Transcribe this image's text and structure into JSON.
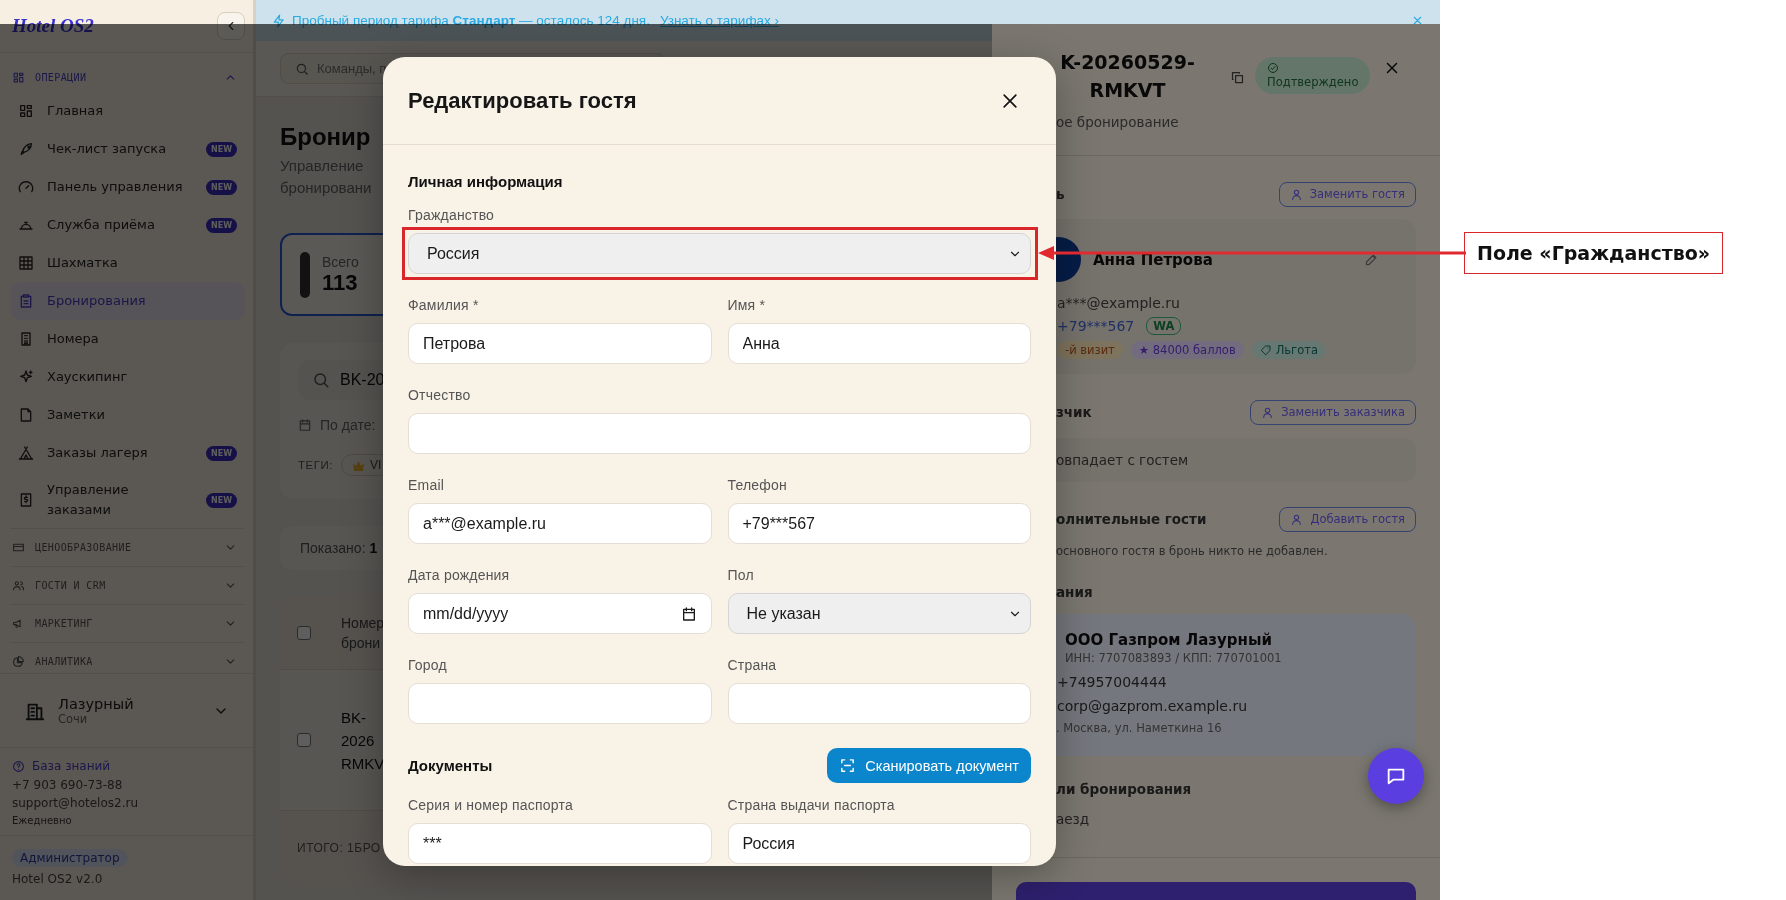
{
  "banner": {
    "text": "Пробный период тарифа **Стандарт** — осталось 124 дня.",
    "link": "Узнать о тарифах ›"
  },
  "sidebar": {
    "logo": "Hotel OS2",
    "sections": [
      {
        "label": "ОПЕРАЦИИ",
        "expanded": true,
        "items": [
          {
            "label": "Главная",
            "selected": false
          },
          {
            "label": "Чек-лист запуска",
            "badge": "NEW",
            "selected": false
          },
          {
            "label": "Панель управления",
            "badge": "NEW",
            "selected": false
          },
          {
            "label": "Служба приёма",
            "badge": "NEW",
            "selected": false
          },
          {
            "label": "Шахматка",
            "selected": false
          },
          {
            "label": "Бронирования",
            "selected": true
          },
          {
            "label": "Номера",
            "selected": false
          },
          {
            "label": "Хаускипинг",
            "selected": false
          },
          {
            "label": "Заметки",
            "selected": false
          },
          {
            "label": "Заказы лагеря",
            "badge": "NEW",
            "selected": false
          },
          {
            "label": "Управление заказами",
            "badge": "NEW",
            "selected": false
          }
        ]
      },
      {
        "label": "ЦЕНООБРАЗОВАНИЕ",
        "expanded": false
      },
      {
        "label": "ГОСТИ И CRM",
        "expanded": false
      },
      {
        "label": "МАРКЕТИНГ",
        "expanded": false
      },
      {
        "label": "АНАЛИТИКА",
        "expanded": false
      }
    ],
    "hotel": {
      "name": "Лазурный",
      "city": "Сочи"
    },
    "help": {
      "link": "База знаний",
      "phone": "+7 903 690-73-88",
      "email": "support@hotelos2.ru",
      "hours": "Ежедневно"
    },
    "role": "Администратор",
    "version": "Hotel OS2 v2.0"
  },
  "search": {
    "placeholder": "Команды, п"
  },
  "page": {
    "title": "Бронир",
    "subtitle_lines": [
      "Управление",
      "бронировани"
    ]
  },
  "stats": [
    {
      "label": "Всего",
      "value": "113",
      "selected": true
    }
  ],
  "filters": {
    "search_value": "BK-20",
    "date_label": "По дате:",
    "tags_label": "ТЕГИ:",
    "tags": [
      {
        "label": "VI"
      }
    ]
  },
  "shown": {
    "label": "Показано:",
    "value": "1"
  },
  "table": {
    "header_checked": false,
    "header_lines": [
      "Номер",
      "брони"
    ],
    "rows": [
      {
        "checked": false,
        "lines": [
          "BK-",
          "2026",
          "RMKV"
        ]
      }
    ],
    "footer": "ИТОГО: 1БРО"
  },
  "details": {
    "number_lines": [
      "K-20260529-",
      "RMKVT"
    ],
    "status": "Подтверждено",
    "subtitle": "ое бронирование",
    "guest_section": {
      "title": "ь",
      "button": "Заменить гостя"
    },
    "guest": {
      "name": "Анна Петрова",
      "email": "a***@example.ru",
      "phone": "+79***567",
      "messenger": "WA",
      "chips": [
        {
          "kind": "visit",
          "label": "-й визит"
        },
        {
          "kind": "points",
          "label": "★ 84000 баллов"
        },
        {
          "kind": "benefit",
          "label": "Льгота"
        }
      ]
    },
    "customer_section": {
      "title": "зчик",
      "button": "Заменить заказчика",
      "note": "овпадает с гостем"
    },
    "extra_section": {
      "title": "олнительные гости",
      "button": "Добавить гостя",
      "note": "основного гостя в бронь никто не добавлен."
    },
    "company_section": {
      "title": "ания",
      "name": "ООО Газпром Лазурный",
      "ids": "ИНН: 7707083893 / КПП: 770701001",
      "phone": "+74957004444",
      "email": "corp@gazprom.example.ru",
      "address": ". Москва, ул. Наметкина 16"
    },
    "booking_section": {
      "title": "ли бронирования",
      "checkin_label": "аезд"
    }
  },
  "modal": {
    "title": "Редактировать гостя",
    "personal_title": "Личная информация",
    "rows": [
      {
        "fields": [
          {
            "label": "Гражданство",
            "kind": "select",
            "value": "Россия",
            "highlighted": true
          }
        ]
      },
      {
        "fields": [
          {
            "label": "Фамилия *",
            "kind": "text",
            "value": "Петрова"
          },
          {
            "label": "Имя *",
            "kind": "text",
            "value": "Анна"
          }
        ]
      },
      {
        "fields": [
          {
            "label": "Отчество",
            "kind": "text"
          }
        ]
      },
      {
        "fields": [
          {
            "label": "Email",
            "kind": "text",
            "value": "a***@example.ru"
          },
          {
            "label": "Телефон",
            "kind": "text",
            "value": "+79***567"
          }
        ]
      },
      {
        "fields": [
          {
            "label": "Дата рождения",
            "kind": "date",
            "placeholder": "mm/dd/yyyy"
          },
          {
            "label": "Пол",
            "kind": "select",
            "value": "Не указан"
          }
        ]
      },
      {
        "fields": [
          {
            "label": "Город",
            "kind": "text"
          },
          {
            "label": "Страна",
            "kind": "text"
          }
        ]
      }
    ],
    "documents_title": "Документы",
    "scan_button": "Сканировать документ",
    "doc_rows": [
      {
        "fields": [
          {
            "label": "Серия и номер паспорта",
            "kind": "text",
            "value": "***"
          },
          {
            "label": "Страна выдачи паспорта",
            "kind": "text",
            "value": "Россия"
          }
        ]
      }
    ]
  },
  "annotation": {
    "label": "Поле «Гражданство»"
  }
}
